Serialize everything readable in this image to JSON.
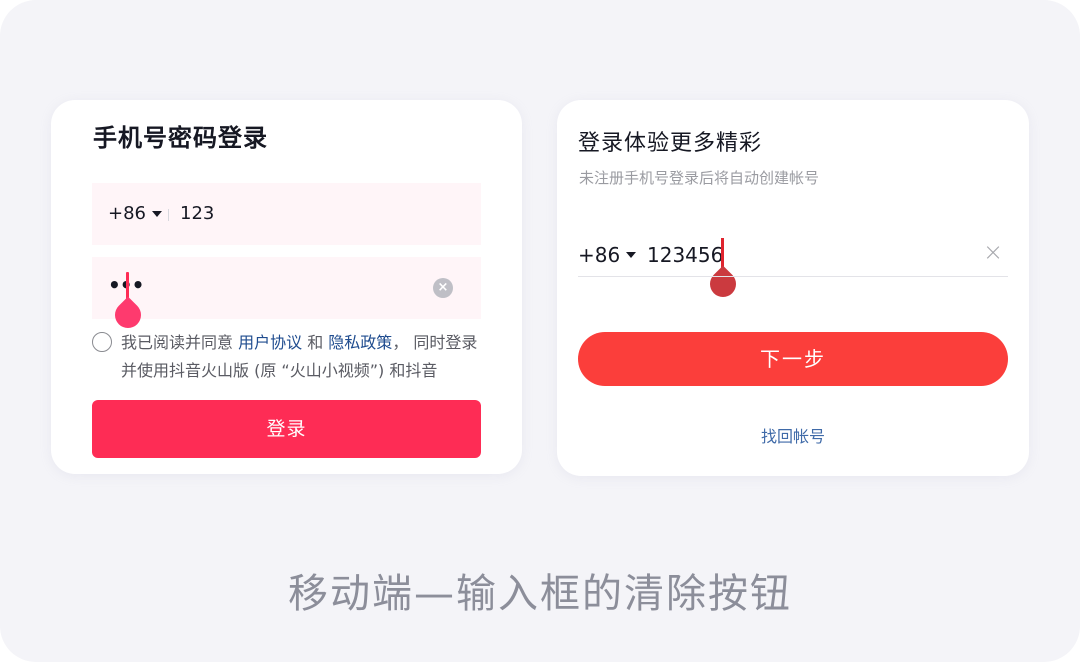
{
  "left_card": {
    "title": "手机号密码登录",
    "country_code": "+86",
    "phone_value": "123",
    "password_mask": "•••",
    "clear_glyph": "×",
    "agreement": {
      "prefix": "我已阅读并同意 ",
      "user_agreement": "用户协议",
      "and": " 和 ",
      "privacy_policy": "隐私政策",
      "suffix": "， 同时登录并使用抖音火山版 (原 “火山小视频”) 和抖音"
    },
    "login_button": "登录"
  },
  "right_card": {
    "title": "登录体验更多精彩",
    "subtitle": "未注册手机号登录后将自动创建帐号",
    "country_code": "+86",
    "phone_value": "123456",
    "clear_glyph": "×",
    "next_button": "下一步",
    "find_account_link": "找回帐号"
  },
  "caption": "移动端—输入框的清除按钮",
  "colors": {
    "background": "#f4f4f8",
    "login_button": "#fe2c55",
    "next_button": "#fb3e3b",
    "link": "#1f4c8f"
  },
  "icons": {
    "dropdown": "caret-down-icon",
    "clear_filled": "clear-circle-icon",
    "clear_plain": "close-icon",
    "radio": "radio-unchecked-icon",
    "cursor_handle": "text-cursor-handle-icon"
  }
}
